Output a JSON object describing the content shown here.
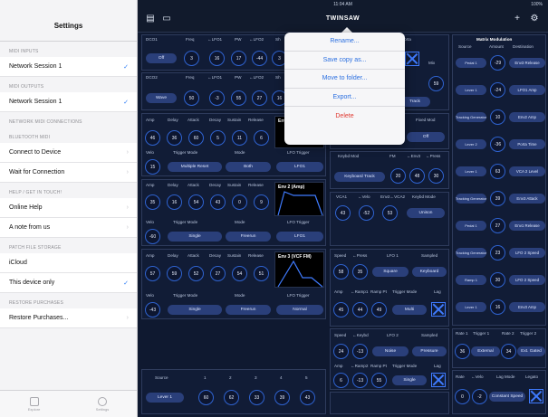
{
  "settings": {
    "title": "Settings",
    "sections": [
      {
        "header": "MIDI INPUTS",
        "rows": [
          {
            "label": "Network Session 1",
            "accessory": "check"
          }
        ]
      },
      {
        "header": "MIDI OUTPUTS",
        "rows": [
          {
            "label": "Network Session 1",
            "accessory": "check"
          }
        ]
      },
      {
        "header": "NETWORK MIDI CONNECTIONS",
        "rows": []
      },
      {
        "header": "BLUETOOTH MIDI",
        "rows": [
          {
            "label": "Connect to Device",
            "accessory": "chevron"
          },
          {
            "label": "Wait for Connection",
            "accessory": "chevron"
          }
        ]
      },
      {
        "header": "HELP / GET IN TOUCH!",
        "rows": [
          {
            "label": "Online Help",
            "accessory": "chevron"
          },
          {
            "label": "A note from us",
            "accessory": "chevron"
          }
        ]
      },
      {
        "header": "PATCH FILE STORAGE",
        "rows": [
          {
            "label": "iCloud",
            "accessory": "none"
          },
          {
            "label": "This device only",
            "accessory": "check"
          }
        ]
      },
      {
        "header": "RESTORE PURCHASES",
        "rows": [
          {
            "label": "Restore Purchases...",
            "accessory": "chevron"
          }
        ]
      }
    ],
    "tabs": [
      "Explore",
      "Settings"
    ]
  },
  "topbar": {
    "time": "11:04 AM",
    "battery": "100%",
    "title": "TWINSAW"
  },
  "menu": {
    "items": [
      "Rename...",
      "Save copy as...",
      "Move to folder...",
      "Export...",
      "Delete"
    ]
  },
  "dco1": {
    "title": "DCO1",
    "cols": [
      "Freq",
      "←LFO1",
      "PW",
      "←LFO2",
      "Sh"
    ],
    "button": "Off",
    "knobs": [
      "3",
      "16",
      "17",
      "-44",
      "3"
    ]
  },
  "dco2": {
    "title": "DCO2",
    "cols": [
      "Freq",
      "←LFO1",
      "PW",
      "←LFO2",
      "Sh"
    ],
    "button": "Wave",
    "knobs": [
      "50",
      "-3",
      "55",
      "27",
      "16"
    ]
  },
  "porta": {
    "label": "Porta",
    "mix": "Mix",
    "knob": "59",
    "button": "Track"
  },
  "env1": {
    "cols": [
      "Amp",
      "Delay",
      "Attack",
      "Decay",
      "Sustain",
      "Release"
    ],
    "knobs": [
      "46",
      "36",
      "60",
      "5",
      "11",
      "6"
    ],
    "row2": [
      "Velo",
      "Trigger Mode",
      "Mode"
    ],
    "velo": "15",
    "trigger": "Multiple Reset",
    "mode": "Both",
    "lfo_trigger_label": "LFO Trigger",
    "lfo_trigger": "LFO1",
    "title": "Env 1"
  },
  "env2": {
    "cols": [
      "Amp",
      "Delay",
      "Attack",
      "Decay",
      "Sustain",
      "Release"
    ],
    "knobs": [
      "35",
      "16",
      "54",
      "43",
      "0",
      "9"
    ],
    "row2": [
      "Velo",
      "Trigger Mode",
      "Mode"
    ],
    "velo": "-60",
    "trigger": "Single",
    "mode": "Freerun",
    "lfo_trigger_label": "LFO Trigger",
    "lfo_trigger": "LFO1",
    "title": "Env 2 (Amp)"
  },
  "env3": {
    "cols": [
      "Amp",
      "Delay",
      "Attack",
      "Decay",
      "Sustain",
      "Release"
    ],
    "knobs": [
      "57",
      "59",
      "52",
      "27",
      "54",
      "51"
    ],
    "row2": [
      "Velo",
      "Trigger Mode",
      "Mode"
    ],
    "velo": "-43",
    "trigger": "Single",
    "mode": "Freerun",
    "lfo_trigger_label": "LFO Trigger",
    "lfo_trigger": "Normal",
    "title": "Env 3 (VCF FM)"
  },
  "fixedmod": {
    "label": "Fixed Mod",
    "button": "Off"
  },
  "keybd": {
    "cols": [
      "Keybd Mod",
      "FM",
      "←Env3",
      "←Press"
    ],
    "button": "Keyboard Track",
    "knobs": [
      "20",
      "48",
      "30"
    ]
  },
  "vca": {
    "cols": [
      "VCA1",
      "←Velo",
      "Env2←VCA2",
      "Keybd Mode"
    ],
    "knobs": [
      "43",
      "-52",
      "53"
    ],
    "button": "Unison"
  },
  "lfo1": {
    "cols": [
      "Speed",
      "←Press",
      "LFO 1",
      "Sampled"
    ],
    "knobs": [
      "58",
      "35"
    ],
    "shape": "Square",
    "sampled": "Keyboard",
    "row2": [
      "Amp",
      "←Ramp1",
      "Ramp Pt",
      "Trigger Mode",
      "Lag"
    ],
    "knobs2": [
      "45",
      "44",
      "49"
    ],
    "trigger": "Multi"
  },
  "lfo2": {
    "cols": [
      "Speed",
      "←Keybd",
      "LFO 2",
      "Sampled"
    ],
    "knobs": [
      "24",
      "-13"
    ],
    "shape": "Noise",
    "sampled": "Pressure",
    "row2": [
      "Amp",
      "←Ramp2",
      "Ramp Pt",
      "Trigger Mode",
      "Lag"
    ],
    "knobs2": [
      "6",
      "-13",
      "55"
    ],
    "trigger": "Single"
  },
  "bottom": {
    "cols": [
      "Source",
      "1",
      "2",
      "3",
      "4",
      "5"
    ],
    "source": "Lever 1",
    "knobs": [
      "60",
      "62",
      "33",
      "39",
      "43"
    ]
  },
  "matrix": {
    "title": "Matrix Modulation",
    "cols": [
      "Source",
      "Amount",
      "Destination"
    ],
    "rows": [
      {
        "source": "Pedal 1",
        "amount": "-29",
        "dest": "Env3 Release"
      },
      {
        "source": "Lever 1",
        "amount": "-24",
        "dest": "LFO1 Amp"
      },
      {
        "source": "Tracking Generator",
        "amount": "10",
        "dest": "Env2 Amp"
      },
      {
        "source": "Lever 2",
        "amount": "-36",
        "dest": "Porta Time"
      },
      {
        "source": "Lever 1",
        "amount": "63",
        "dest": "VCA 2 Level"
      },
      {
        "source": "Tracking Generator",
        "amount": "39",
        "dest": "Env3 Attack"
      },
      {
        "source": "Pedal 1",
        "amount": "27",
        "dest": "Env1 Release"
      },
      {
        "source": "Tracking Generator",
        "amount": "23",
        "dest": "LFO 2 Speed"
      },
      {
        "source": "Ramp 1",
        "amount": "30",
        "dest": "LFO 2 Speed"
      },
      {
        "source": "Lever 1",
        "amount": "16",
        "dest": "Env3 Amp"
      }
    ]
  },
  "ramps": {
    "cols": [
      "Rate 1",
      "Trigger 1",
      "Rate 2",
      "Trigger 2"
    ],
    "knob1": "36",
    "trig1": "External",
    "knob2": "34",
    "trig2": "Ext. Gated"
  },
  "lag": {
    "cols": [
      "Rate",
      "←Velo",
      "Lag Mode",
      "Legato"
    ],
    "knob1": "0",
    "knob2": "-2",
    "mode": "Constant Speed"
  }
}
